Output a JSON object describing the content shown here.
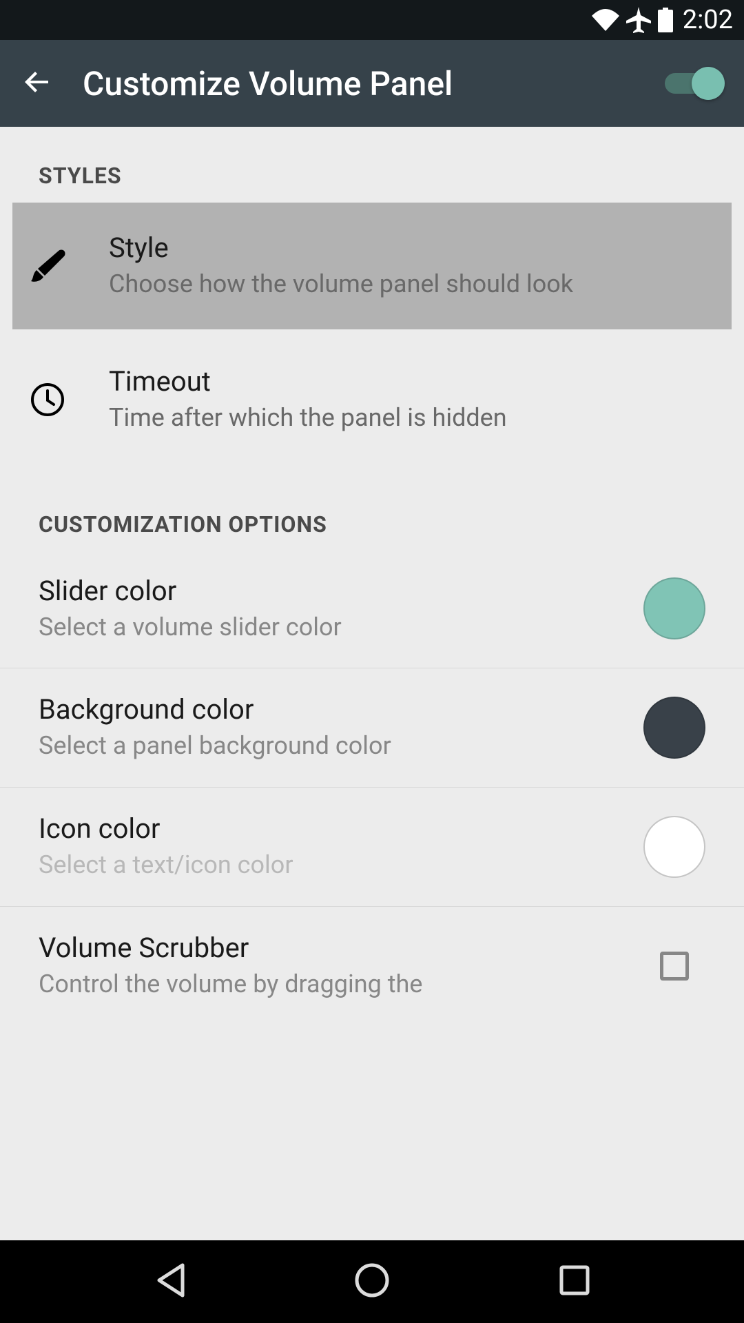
{
  "statusBar": {
    "time": "2:02"
  },
  "appBar": {
    "title": "Customize Volume Panel",
    "toggleEnabled": true
  },
  "sections": {
    "styles": {
      "header": "STYLES",
      "items": [
        {
          "title": "Style",
          "desc": "Choose how the volume panel should look"
        },
        {
          "title": "Timeout",
          "desc": "Time after which the panel is hidden"
        }
      ]
    },
    "customization": {
      "header": "CUSTOMIZATION OPTIONS",
      "items": [
        {
          "title": "Slider color",
          "desc": "Select a volume slider color",
          "color": "#80c4b5"
        },
        {
          "title": "Background color",
          "desc": "Select a panel background color",
          "color": "#394149"
        },
        {
          "title": "Icon color",
          "desc": "Select a text/icon color",
          "color": "#ffffff"
        },
        {
          "title": "Volume Scrubber",
          "desc": "Control the volume by dragging the"
        }
      ]
    }
  }
}
